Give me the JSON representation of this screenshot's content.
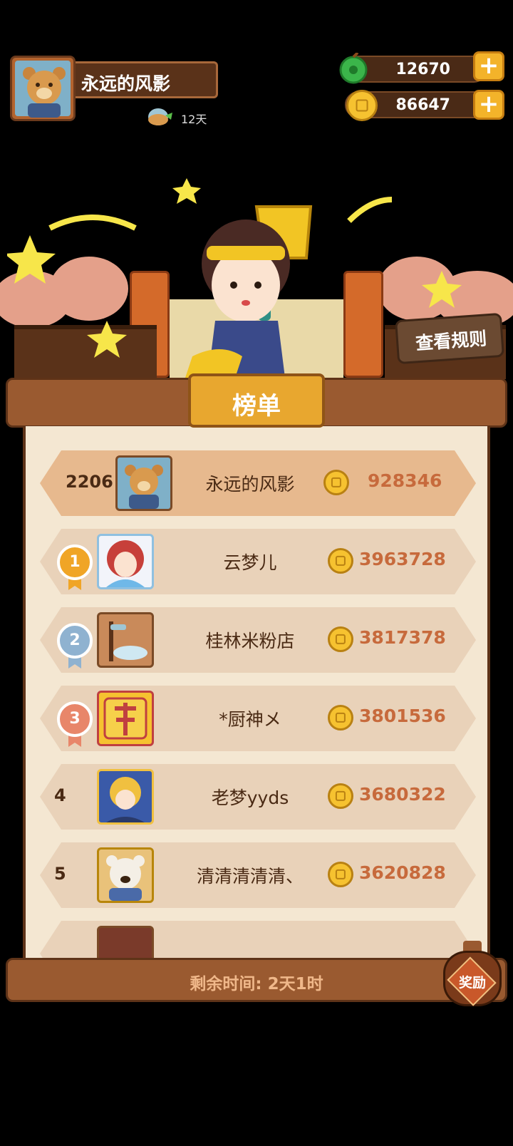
{
  "player": {
    "name": "永远的风影",
    "days": "12天"
  },
  "currencies": {
    "gems": "12670",
    "coins": "86647"
  },
  "rules_button": "查看规则",
  "board_title": "榜单",
  "my_row": {
    "rank": "2206",
    "name": "永远的风影",
    "score": "928346"
  },
  "rows": [
    {
      "rank": "1",
      "name": "云梦儿",
      "score": "3963728"
    },
    {
      "rank": "2",
      "name": "桂林米粉店",
      "score": "3817378"
    },
    {
      "rank": "3",
      "name": "*厨神メ",
      "score": "3801536"
    },
    {
      "rank": "4",
      "name": "老梦yyds",
      "score": "3680322"
    },
    {
      "rank": "5",
      "name": "清清清清清、",
      "score": "3620828"
    }
  ],
  "timer": "剩余时间: 2天1时",
  "reward_button": "奖励",
  "colors": {
    "accent": "#e8a72f",
    "score": "#c76a3c",
    "board_bg": "#f4e7d2"
  }
}
